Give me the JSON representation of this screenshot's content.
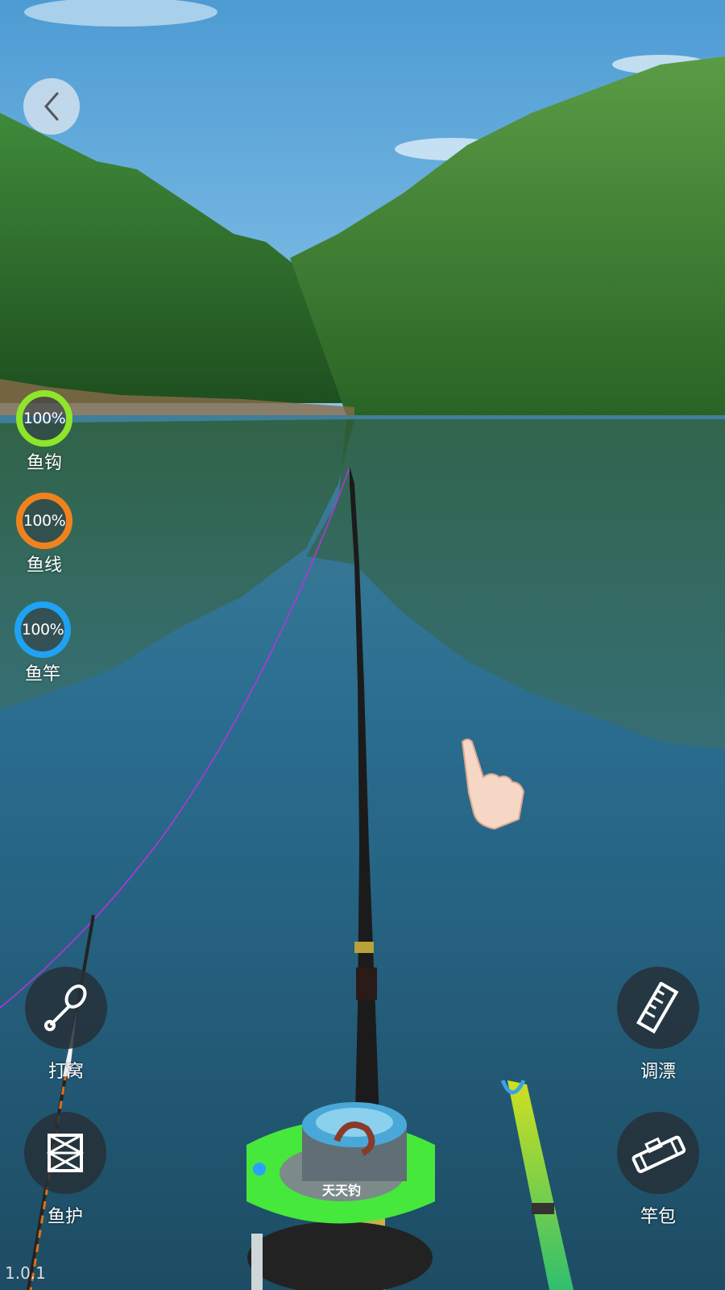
{
  "colors": {
    "sky": "#5aa5d8",
    "water": "#1f5e7e",
    "hook_ring": "#8ee62a",
    "line_ring": "#f0821e",
    "rod_ring": "#1fa2f2",
    "fishing_line": "#b435d8",
    "bait_box": "#46e83c"
  },
  "gauges": [
    {
      "percent": "100%",
      "label": "鱼钩",
      "color": "#8ee62a"
    },
    {
      "percent": "100%",
      "label": "鱼线",
      "color": "#f0821e"
    },
    {
      "percent": "100%",
      "label": "鱼竿",
      "color": "#1fa2f2"
    }
  ],
  "actions": {
    "chum": {
      "label": "打窝",
      "icon": "chum-spoon-icon"
    },
    "fish_net": {
      "label": "鱼护",
      "icon": "fish-net-icon"
    },
    "adjust_float": {
      "label": "调漂",
      "icon": "ruler-icon"
    },
    "rod_bag": {
      "label": "竿包",
      "icon": "rod-bag-icon"
    }
  },
  "bait_box_label": "天天钓",
  "version": "1.0.1"
}
